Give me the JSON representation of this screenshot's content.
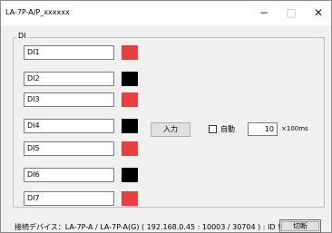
{
  "window": {
    "title": "LA-7P-A/P_xxxxxx",
    "minimize": "−",
    "maximize": "□",
    "close": "✕"
  },
  "group": {
    "label": "DI"
  },
  "inputs": [
    {
      "label": "DI1",
      "state_color": "#e84040"
    },
    {
      "label": "DI2",
      "state_color": "#000000"
    },
    {
      "label": "DI3",
      "state_color": "#e84040"
    },
    {
      "label": "DI4",
      "state_color": "#000000"
    },
    {
      "label": "DI5",
      "state_color": "#e84040"
    },
    {
      "label": "DI6",
      "state_color": "#000000"
    },
    {
      "label": "DI7",
      "state_color": "#e84040"
    }
  ],
  "controls": {
    "input_button": "入力",
    "auto_label": "自動",
    "auto_checked": false,
    "interval_value": "10",
    "interval_unit": "×100ms"
  },
  "status": {
    "connection_text": "接続デバイス：LA-7P-A / LA-7P-A(G) ( 192.168.0.45 : 10003 / 30704 ) : ID !",
    "disconnect_button": "切断"
  }
}
